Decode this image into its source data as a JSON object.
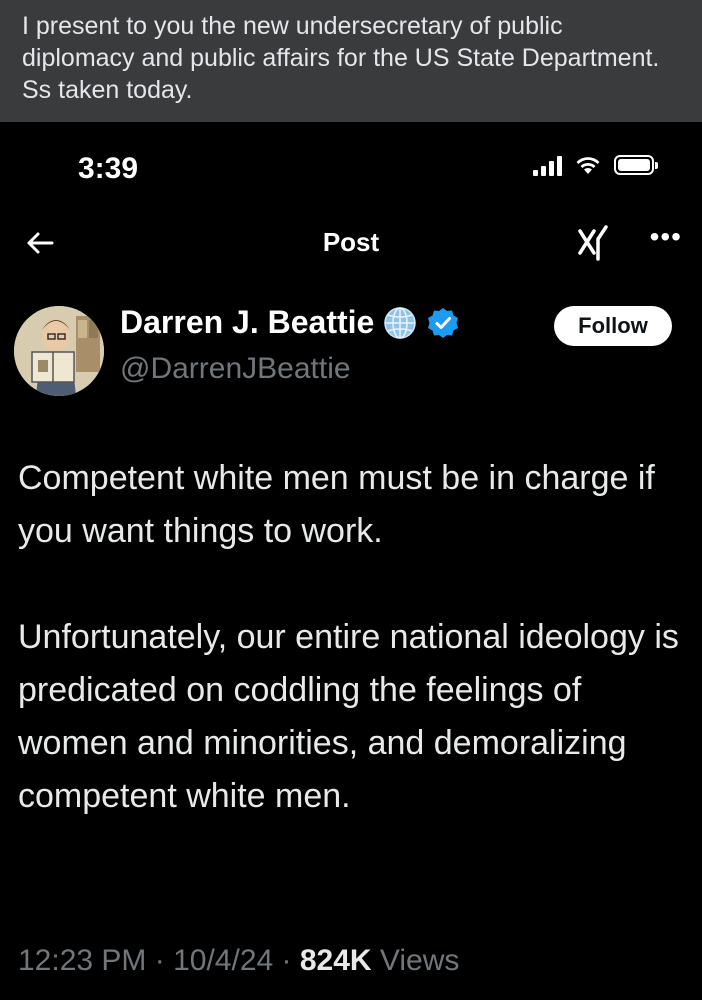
{
  "caption": {
    "text": "I present to you the new undersecretary of public diplomacy and public affairs for the US State Department. Ss taken today."
  },
  "status_bar": {
    "time": "3:39",
    "icons": [
      "signal-icon",
      "wifi-icon",
      "battery-icon"
    ]
  },
  "nav": {
    "back_icon": "arrow-left-icon",
    "title": "Post",
    "grok_icon": "grok-icon",
    "more_icon": "more-icon"
  },
  "author": {
    "name": "Darren J. Beattie",
    "handle": "@DarrenJBeattie",
    "badges": [
      "globe-icon",
      "verified-badge-icon"
    ],
    "follow_label": "Follow"
  },
  "tweet": {
    "paragraphs": [
      "Competent white men must be in charge if you want things to work.",
      "Unfortunately, our entire national ideology is predicated on coddling the feelings of women and minorities, and demoralizing competent white men."
    ]
  },
  "meta": {
    "time": "12:23 PM",
    "date": "10/4/24",
    "views_count": "824K",
    "views_label": "Views"
  },
  "colors": {
    "background": "#000000",
    "caption_bg": "#3a3b3c",
    "text": "#e7e9ea",
    "secondary": "#71767b",
    "verified": "#1d9bf0"
  }
}
